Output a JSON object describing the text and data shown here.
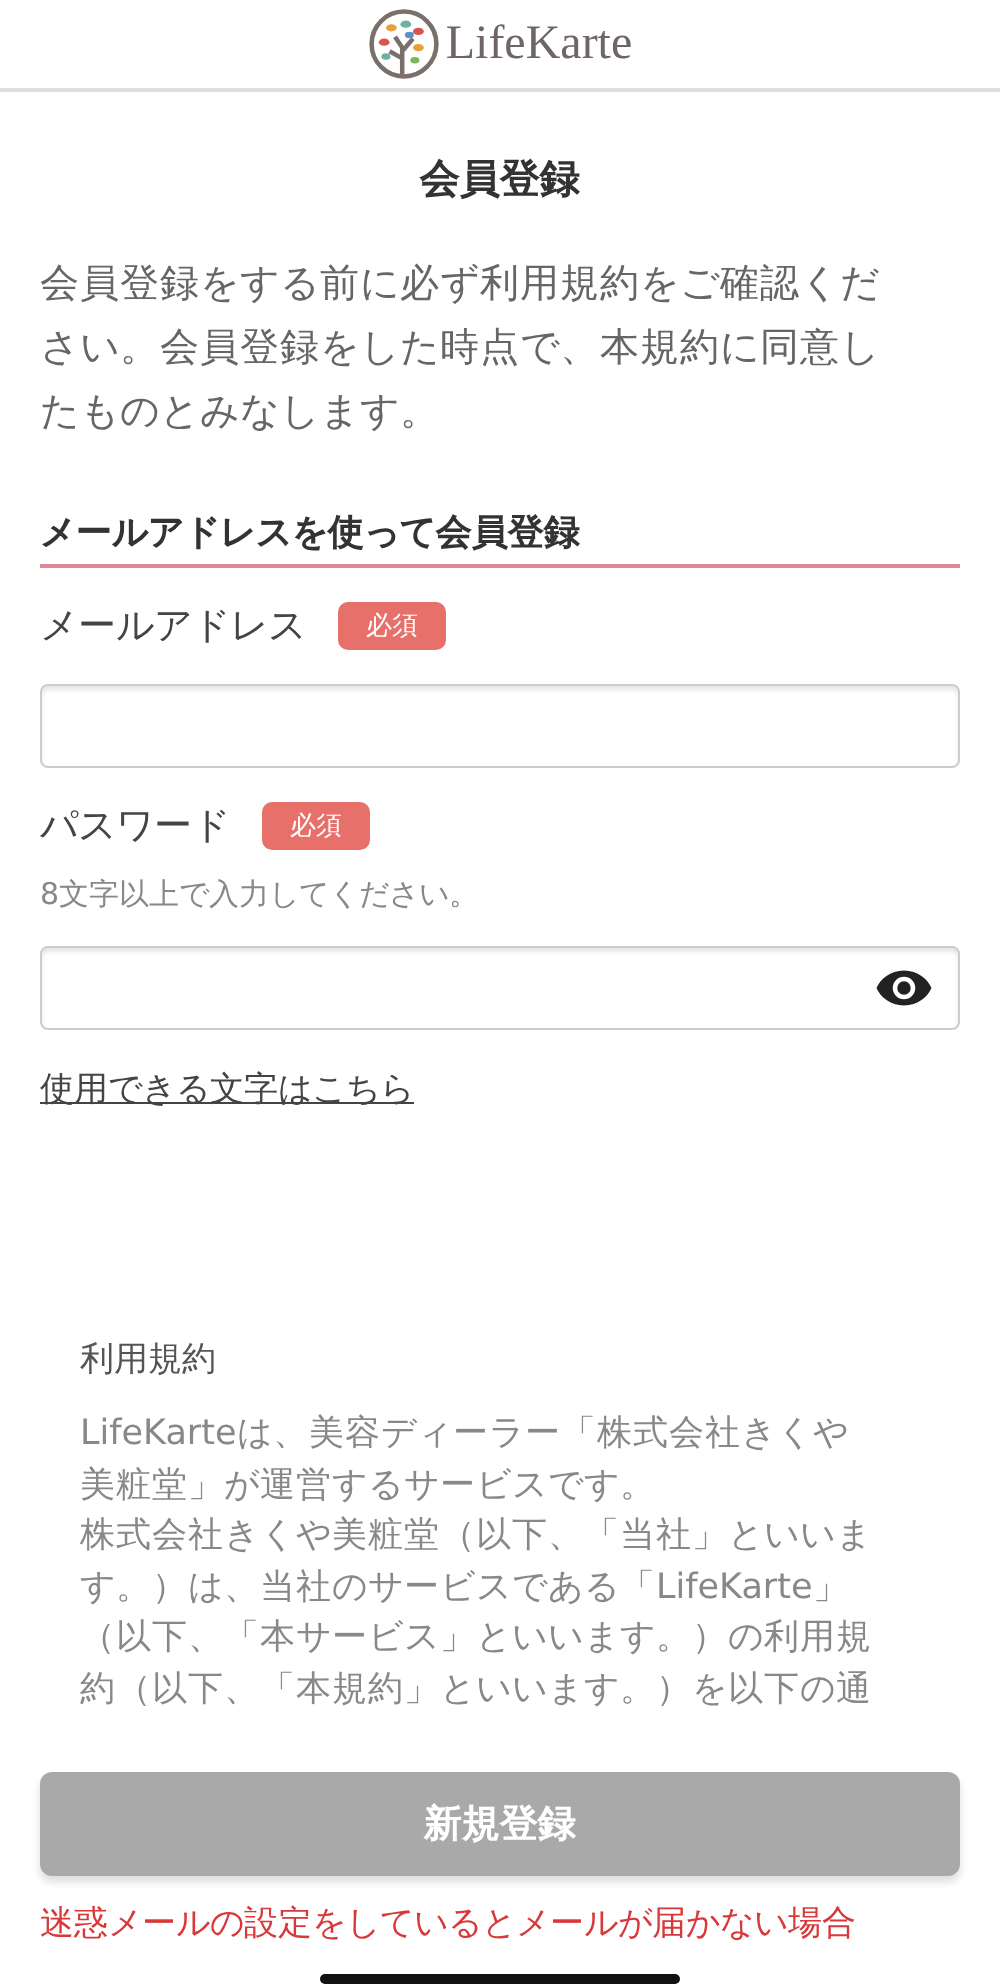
{
  "header": {
    "logo_text": "LifeKarte"
  },
  "title": "会員登録",
  "intro": "会員登録をする前に必ず利用規約をご確認ください。会員登録をした時点で、本規約に同意したものとみなします。",
  "section_heading": "メールアドレスを使って会員登録",
  "fields": [
    {
      "kind": "email",
      "label": "メールアドレス",
      "badge": "必須"
    },
    {
      "kind": "password",
      "label": "パスワード",
      "badge": "必須",
      "hint": "8文字以上で入力してください。"
    }
  ],
  "chars_link": "使用できる文字はこちら",
  "terms": {
    "title": "利用規約",
    "paragraphs": [
      "LifeKarteは、美容ディーラー「株式会社きくや美粧堂」が運営するサービスです。",
      "株式会社きくや美粧堂（以下、「当社」といいます。）は、当社のサービスである「LifeKarte」（以下、「本サービス」といいます。）の利用規約（以下、「本規約」といいます。）を以下の通"
    ]
  },
  "submit": {
    "label": "新規登録",
    "disabled": true
  },
  "notice": "迷惑メールの設定をしているとメールが届かない場合"
}
